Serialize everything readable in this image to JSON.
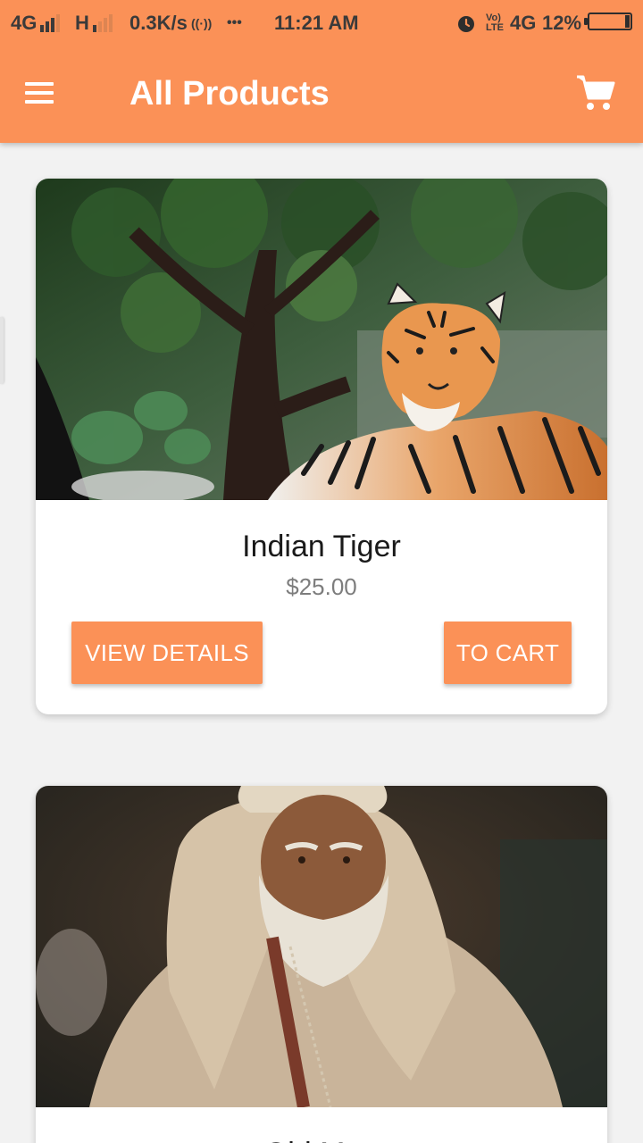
{
  "status_bar": {
    "network1": "4G",
    "network2": "H",
    "speed": "0.3K/s",
    "hotspot": "((·))",
    "more": "•••",
    "time": "11:21 AM",
    "volte": "Vo) LTE",
    "network3": "4G",
    "battery_percent": "12%",
    "battery_level": 0.12
  },
  "header": {
    "title": "All Products",
    "menu_icon": "menu-icon",
    "cart_icon": "cart-icon"
  },
  "colors": {
    "primary": "#fb9157",
    "background": "#f2f2f2",
    "card": "#ffffff",
    "price_text": "#7d7d7d"
  },
  "products": [
    {
      "name": "Indian Tiger",
      "price": "$25.00",
      "image": "tiger-photo",
      "view_details_label": "VIEW DETAILS",
      "to_cart_label": "TO CART"
    },
    {
      "name": "Old Man",
      "image": "old-man-photo"
    }
  ]
}
